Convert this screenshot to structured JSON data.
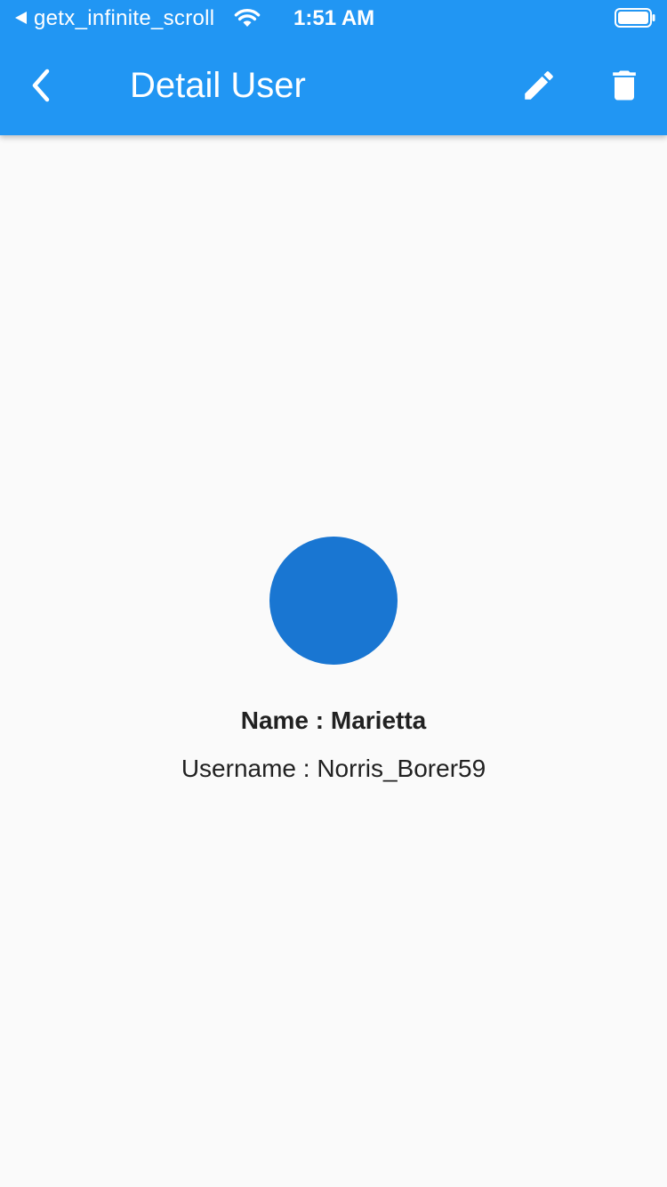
{
  "status_bar": {
    "back_app_name": "getx_infinite_scroll",
    "time": "1:51 AM"
  },
  "app_bar": {
    "title": "Detail User",
    "background_color": "#2196f3",
    "icons": {
      "back": "chevron-left-icon",
      "edit": "pencil-icon",
      "delete": "trash-icon"
    }
  },
  "user": {
    "name_line": "Name : Marietta",
    "username_line": "Username : Norris_Borer59",
    "avatar_color": "#1976d2"
  }
}
